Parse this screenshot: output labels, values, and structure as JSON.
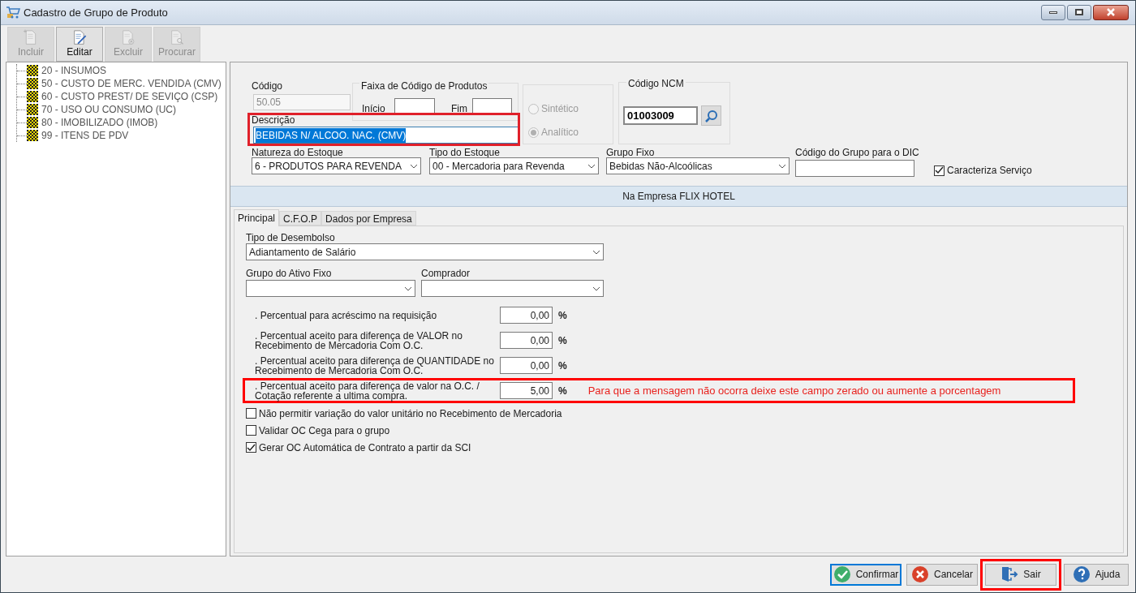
{
  "window": {
    "title": "Cadastro de Grupo de Produto"
  },
  "toolbar": [
    {
      "label": "Incluir",
      "kind": "add",
      "disabled": true
    },
    {
      "label": "Editar",
      "kind": "edit",
      "disabled": false
    },
    {
      "label": "Excluir",
      "kind": "delete",
      "disabled": true
    },
    {
      "label": "Procurar",
      "kind": "search",
      "disabled": true
    }
  ],
  "tree": [
    {
      "label": "20 - INSUMOS"
    },
    {
      "label": "50 - CUSTO DE MERC. VENDIDA (CMV)"
    },
    {
      "label": "60 - CUSTO PREST/ DE SEVIÇO (CSP)"
    },
    {
      "label": "70 - USO OU CONSUMO (UC)"
    },
    {
      "label": "80 - IMOBILIZADO (IMOB)"
    },
    {
      "label": "99 - ITENS DE PDV"
    }
  ],
  "form": {
    "codigo": {
      "label": "Código",
      "value": "50.05"
    },
    "faixa": {
      "title": "Faixa de Código de Produtos",
      "inicio_label": "Início",
      "fim_label": "Fim"
    },
    "tipo": [
      {
        "label": "Sintético",
        "selected": false
      },
      {
        "label": "Analítico",
        "selected": true
      }
    ],
    "ncm": {
      "title": "Código NCM",
      "value": "01003009"
    },
    "descricao": {
      "label": "Descrição",
      "value": "BEBIDAS N/ ALCOO. NAC. (CMV)",
      "highlighted": true
    },
    "natureza": {
      "label": "Natureza do Estoque",
      "value": "6 - PRODUTOS PARA REVENDA"
    },
    "tipo_estoque": {
      "label": "Tipo do Estoque",
      "value": "00 - Mercadoria para Revenda"
    },
    "grupo_fixo": {
      "label": "Grupo Fixo",
      "value": "Bebidas Não-Alcoólicas"
    },
    "dic": {
      "label": "Código do Grupo para o DIC"
    },
    "caracteriza": {
      "label": "Caracteriza Serviço",
      "checked": true
    }
  },
  "company_banner": "Na Empresa FLIX HOTEL",
  "tabs": [
    {
      "label": "Principal",
      "selected": true
    },
    {
      "label": "C.F.O.P",
      "selected": false
    },
    {
      "label": "Dados por Empresa",
      "selected": false
    }
  ],
  "principal": {
    "tipo_desembolso": {
      "label": "Tipo de Desembolso",
      "value": "Adiantamento de Salário"
    },
    "grupo_ativo": {
      "label": "Grupo do Ativo Fixo"
    },
    "comprador": {
      "label": "Comprador"
    },
    "percentuais": [
      {
        "label": ". Percentual para acréscimo na requisição",
        "value": "0,00",
        "unit": "%",
        "highlighted": false
      },
      {
        "label": ". Percentual aceito para diferença de VALOR no\nRecebimento de Mercadoria Com O.C.",
        "value": "0,00",
        "unit": "%",
        "highlighted": false
      },
      {
        "label": ". Percentual aceito para diferença de QUANTIDADE no\nRecebimento de Mercadoria Com O.C.",
        "value": "0,00",
        "unit": "%",
        "highlighted": false
      },
      {
        "label": ". Percentual aceito para diferença de valor na O.C. /\nCotação referente a ultima compra.",
        "value": "5,00",
        "unit": "%",
        "highlighted": true,
        "note": "Para que a mensagem não ocorra deixe este campo zerado ou aumente a porcentagem"
      }
    ],
    "checkboxes": [
      {
        "label": "Não permitir variação do valor unitário no Recebimento de Mercadoria",
        "checked": false
      },
      {
        "label": "Validar OC Cega para o grupo",
        "checked": false
      },
      {
        "label": "Gerar OC Automática de Contrato a partir da SCI",
        "checked": true
      }
    ]
  },
  "buttons": [
    {
      "label": "Confirmar",
      "kind": "confirm",
      "focused": true,
      "highlighted": false
    },
    {
      "label": "Cancelar",
      "kind": "cancel",
      "focused": false,
      "highlighted": false
    },
    {
      "label": "Sair",
      "kind": "exit",
      "focused": false,
      "highlighted": true
    },
    {
      "label": "Ajuda",
      "kind": "help",
      "focused": false,
      "highlighted": false
    }
  ]
}
